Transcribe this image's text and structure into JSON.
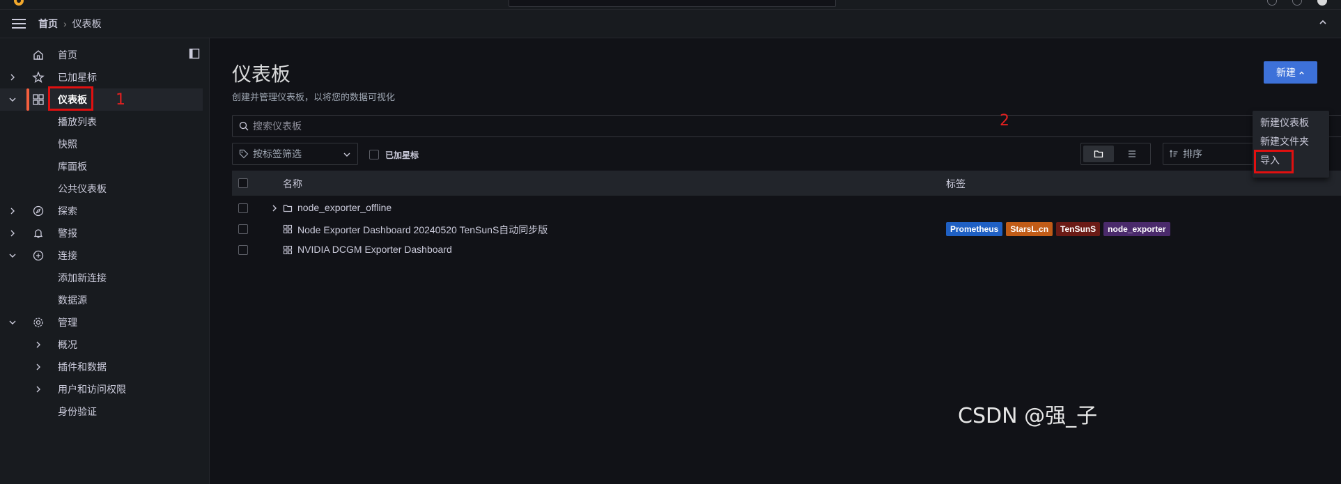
{
  "breadcrumb": {
    "home": "首页",
    "separator": "›",
    "current": "仪表板"
  },
  "sidebar": {
    "items": [
      {
        "label": "首页",
        "icon": "home-icon"
      },
      {
        "label": "已加星标",
        "icon": "star-icon"
      },
      {
        "label": "仪表板",
        "icon": "apps-icon"
      },
      {
        "label": "播放列表"
      },
      {
        "label": "快照"
      },
      {
        "label": "库面板"
      },
      {
        "label": "公共仪表板"
      },
      {
        "label": "探索",
        "icon": "compass-icon"
      },
      {
        "label": "警报",
        "icon": "bell-icon"
      },
      {
        "label": "连接",
        "icon": "link-icon"
      },
      {
        "label": "添加新连接"
      },
      {
        "label": "数据源"
      },
      {
        "label": "管理",
        "icon": "cog-icon"
      },
      {
        "label": "概况"
      },
      {
        "label": "插件和数据"
      },
      {
        "label": "用户和访问权限"
      },
      {
        "label": "身份验证"
      }
    ]
  },
  "annotations": {
    "one": "1",
    "two": "2"
  },
  "page": {
    "title": "仪表板",
    "subtitle": "创建并管理仪表板，以将您的数据可视化",
    "new_button": "新建"
  },
  "search": {
    "placeholder": "搜索仪表板"
  },
  "filters": {
    "tag_filter": "按标签筛选",
    "starred": "已加星标",
    "sort": "排序"
  },
  "table": {
    "headers": {
      "name": "名称",
      "tags": "标签"
    },
    "rows": [
      {
        "name": "node_exporter_offline",
        "type": "folder"
      },
      {
        "name": "Node Exporter Dashboard 20240520 TenSunS自动同步版",
        "type": "dashboard",
        "tags": [
          {
            "label": "Prometheus",
            "color": "#1f60c4"
          },
          {
            "label": "StarsL.cn",
            "color": "#c15c17"
          },
          {
            "label": "TenSunS",
            "color": "#6b1b16"
          },
          {
            "label": "node_exporter",
            "color": "#4a2a6b"
          }
        ]
      },
      {
        "name": "NVIDIA DCGM Exporter Dashboard",
        "type": "dashboard"
      }
    ]
  },
  "new_menu": {
    "items": [
      "新建仪表板",
      "新建文件夹",
      "导入"
    ]
  },
  "watermark": "CSDN @强_子",
  "colors": {
    "accent": "#3d71d9",
    "active_bar": "#f55f3e",
    "annotation": "#e01010"
  }
}
